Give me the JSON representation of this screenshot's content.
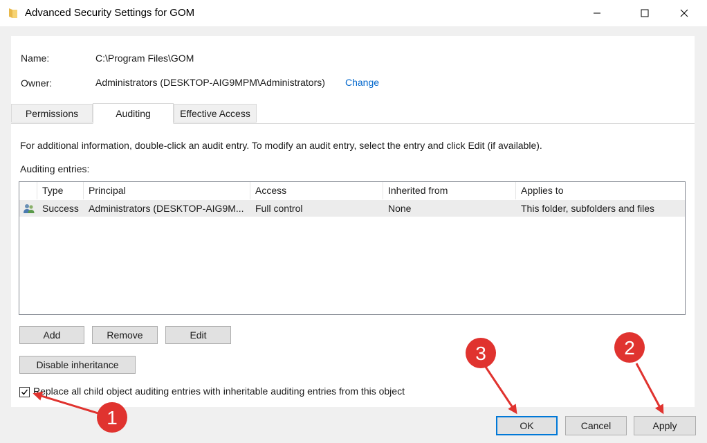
{
  "window": {
    "title": "Advanced Security Settings for GOM",
    "icon": "folder-icon",
    "controls": [
      "minimize-icon",
      "maximize-icon",
      "close-icon"
    ]
  },
  "info": {
    "name_label": "Name:",
    "name_value": "C:\\Program Files\\GOM",
    "owner_label": "Owner:",
    "owner_value": "Administrators (DESKTOP-AIG9MPM\\Administrators)",
    "change_link": "Change"
  },
  "tabs": [
    {
      "label": "Permissions",
      "active": false
    },
    {
      "label": "Auditing",
      "active": true
    },
    {
      "label": "Effective Access",
      "active": false
    }
  ],
  "auditing": {
    "description": "For additional information, double-click an audit entry. To modify an audit entry, select the entry and click Edit (if available).",
    "entries_label": "Auditing entries:",
    "columns": [
      "Type",
      "Principal",
      "Access",
      "Inherited from",
      "Applies to"
    ],
    "rows": [
      {
        "icon": "users-icon",
        "type": "Success",
        "principal": "Administrators (DESKTOP-AIG9M...",
        "access": "Full control",
        "inherited_from": "None",
        "applies_to": "This folder, subfolders and files"
      }
    ],
    "add_label": "Add",
    "remove_label": "Remove",
    "edit_label": "Edit",
    "disable_inheritance_label": "Disable inheritance",
    "replace_checkbox_label": "Replace all child object auditing entries with inheritable auditing entries from this object",
    "replace_checked": true
  },
  "footer": {
    "ok_label": "OK",
    "cancel_label": "Cancel",
    "apply_label": "Apply"
  },
  "annotations": [
    {
      "number": "1",
      "target": "replace-checkbox"
    },
    {
      "number": "2",
      "target": "apply-button"
    },
    {
      "number": "3",
      "target": "ok-button"
    }
  ],
  "colors": {
    "annotation_red": "#e0332f",
    "link_blue": "#0066cc",
    "focus_blue": "#0078d7"
  }
}
